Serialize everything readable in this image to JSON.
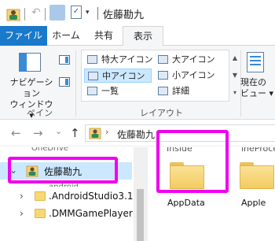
{
  "title_bar": {
    "title": "佐藤勘九",
    "qa_dropdown": "▾",
    "undo_glyph": "↶",
    "check_glyph": "✓"
  },
  "tabs": [
    {
      "label": "ファイル"
    },
    {
      "label": "ホーム"
    },
    {
      "label": "共有"
    },
    {
      "label": "表示"
    }
  ],
  "ribbon": {
    "nav_pane_label_1": "ナビゲーション",
    "nav_pane_label_2": "ウィンドウ ▾",
    "pane_group": "ペイン",
    "layout_group": "レイアウト",
    "layout_items": [
      {
        "label": "特大アイコン"
      },
      {
        "label": "大アイコン"
      },
      {
        "label": "中アイコン"
      },
      {
        "label": "小アイコン"
      },
      {
        "label": "一覧"
      },
      {
        "label": "詳細"
      }
    ],
    "current_view_1": "現在の",
    "current_view_2": "ビュー ▾",
    "scroll_up": "▲",
    "scroll_down": "▼",
    "scroll_more": "▾"
  },
  "address": {
    "back": "←",
    "forward": "→",
    "dropdown": "⌄",
    "up": "↑",
    "path_chevron": "›",
    "path": "佐藤勘九"
  },
  "nav_pane": {
    "cut_top": "OneDrive",
    "selected": {
      "label": "佐藤勘九",
      "chevron": "⌄"
    },
    "cut_mid": "android",
    "items": [
      {
        "label": ".AndroidStudio3.1",
        "chevron": "›"
      },
      {
        "label": ".DMMGamePlayer",
        "chevron": "›"
      }
    ]
  },
  "content": {
    "cut_labels": [
      "Inside",
      "ineProce"
    ],
    "folders": [
      {
        "label": "AppData"
      },
      {
        "label": "Apple"
      }
    ]
  },
  "colors": {
    "accent": "#1979ca",
    "highlight": "#f000f0",
    "selection": "#cce8ff"
  }
}
